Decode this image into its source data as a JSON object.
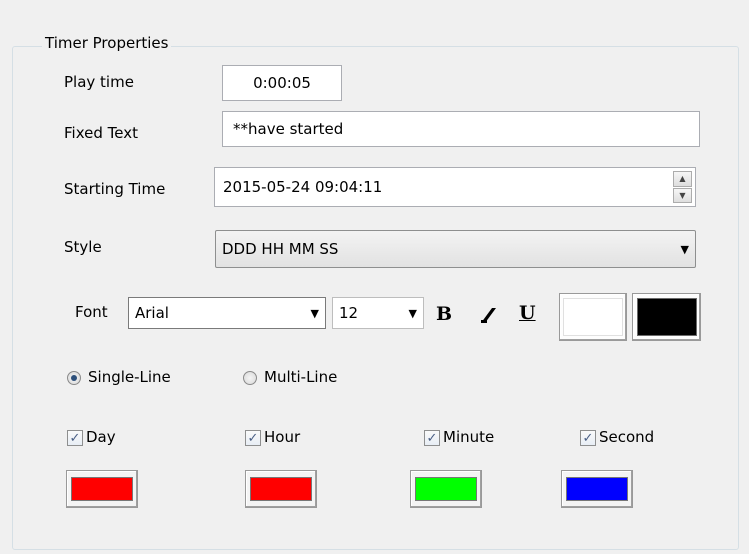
{
  "group": {
    "title": "Timer Properties"
  },
  "play_time": {
    "label": "Play time",
    "value": "0:00:05"
  },
  "fixed_text": {
    "label": "Fixed Text",
    "value": "**have started"
  },
  "starting_time": {
    "label": "Starting Time",
    "value": "2015-05-24 09:04:11"
  },
  "style": {
    "label": "Style",
    "value": "DDD HH MM SS"
  },
  "font": {
    "label": "Font",
    "family": "Arial",
    "size": "12",
    "bold_label": "B",
    "italic_label": "I",
    "underline_label": "U",
    "background_color": "#ffffff",
    "text_color": "#000000"
  },
  "layout_mode": {
    "single_label": "Single-Line",
    "multi_label": "Multi-Line",
    "selected": "single"
  },
  "units": [
    {
      "label": "Day",
      "checked": true,
      "color": "#ff0000"
    },
    {
      "label": "Hour",
      "checked": true,
      "color": "#ff0000"
    },
    {
      "label": "Minute",
      "checked": true,
      "color": "#00ff00"
    },
    {
      "label": "Second",
      "checked": true,
      "color": "#0000ff"
    }
  ]
}
